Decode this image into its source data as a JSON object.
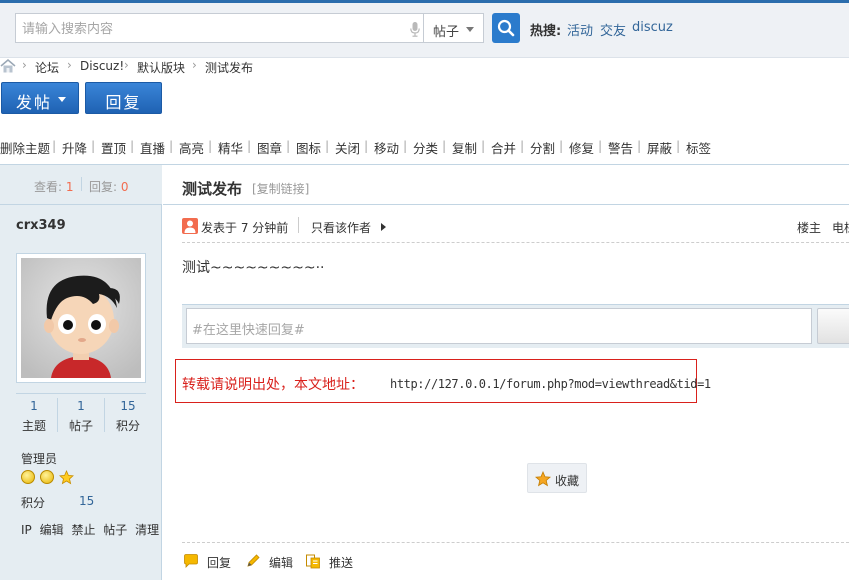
{
  "search": {
    "placeholder": "请输入搜索内容",
    "type_label": "帖子",
    "hot_label": "热搜:",
    "hot_links": [
      "活动",
      "交友",
      "discuz"
    ]
  },
  "breadcrumb": {
    "items": [
      "论坛",
      "Discuz!",
      "默认版块",
      "测试发布"
    ],
    "separator": "›"
  },
  "buttons": {
    "post_label": "发帖",
    "reply_label": "回复"
  },
  "mod_toolbar": {
    "items": [
      "删除主题",
      "升降",
      "置顶",
      "直播",
      "高亮",
      "精华",
      "图章",
      "图标",
      "关闭",
      "移动",
      "分类",
      "复制",
      "合并",
      "分割",
      "修复",
      "警告",
      "屏蔽",
      "标签"
    ],
    "separator": "|"
  },
  "thread": {
    "views_label": "查看:",
    "views": "1",
    "replies_label": "回复:",
    "replies": "0",
    "title": "测试发布",
    "copy_link": "[复制链接]"
  },
  "author": {
    "name": "crx349",
    "stats": [
      {
        "value": "1",
        "label": "主题"
      },
      {
        "value": "1",
        "label": "帖子"
      },
      {
        "value": "15",
        "label": "积分"
      }
    ],
    "group": "管理员",
    "credit_label": "积分",
    "credit_value": "15",
    "admin_links": [
      "IP",
      "编辑",
      "禁止",
      "帖子",
      "清理"
    ]
  },
  "post": {
    "posted_text": "发表于 7 分钟前",
    "only_author": "只看该作者",
    "floor": "楼主",
    "elec": "电梯",
    "body": "测试~~~~~~~~~··",
    "quick_reply_placeholder": "#在这里快速回复#"
  },
  "notice": {
    "label": "转载请说明出处，本文地址：",
    "url": "http://127.0.0.1/forum.php?mod=viewthread&tid=1"
  },
  "favorite_label": "收藏",
  "footer_actions": [
    {
      "icon": "reply-icon",
      "label": "回复"
    },
    {
      "icon": "edit-icon",
      "label": "编辑"
    },
    {
      "icon": "share-icon",
      "label": "推送"
    }
  ],
  "colors": {
    "accent_blue": "#2b6dad",
    "sidebar_bg": "#e5edf2",
    "notice_red": "#d9211c",
    "link_blue": "#336699"
  }
}
